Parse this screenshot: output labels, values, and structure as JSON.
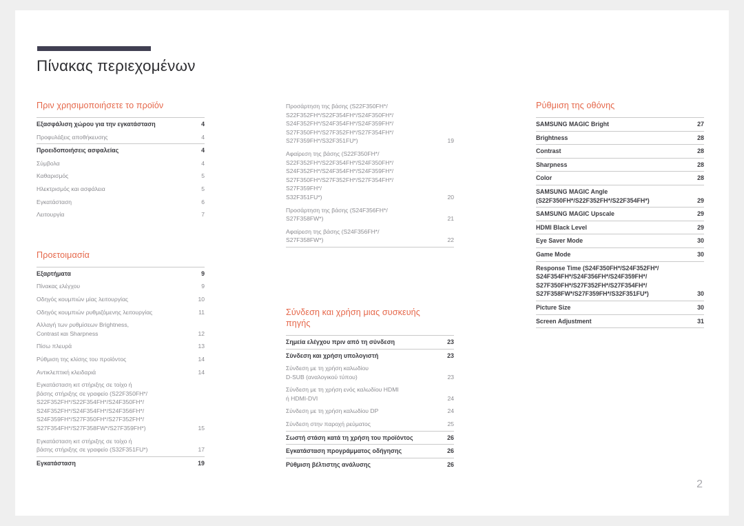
{
  "document": {
    "title": "Πίνακας περιεχομένων",
    "page_number": "2",
    "accent_color": "#e5674a",
    "rule_color": "#403f52",
    "text_color": "#3b3b40",
    "muted_text_color": "#8b8b90",
    "page_background": "#ffffff",
    "canvas_background": "#efefef"
  },
  "columns": [
    {
      "name": "column-left",
      "sections": [
        {
          "heading": "Πριν χρησιμοποιήσετε το προϊόν",
          "groups": [
            {
              "entries": [
                {
                  "label": "Εξασφάλιση χώρου για την εγκατάσταση",
                  "page": "4",
                  "level": "major"
                },
                {
                  "label": "Προφυλάξεις αποθήκευσης",
                  "page": "4",
                  "level": "minor"
                }
              ]
            },
            {
              "entries": [
                {
                  "label": "Προειδοποιήσεις ασφαλείας",
                  "page": "4",
                  "level": "major"
                },
                {
                  "label": "Σύμβολα",
                  "page": "4",
                  "level": "minor"
                },
                {
                  "label": "Καθαρισμός",
                  "page": "5",
                  "level": "minor"
                },
                {
                  "label": "Ηλεκτρισμός και ασφάλεια",
                  "page": "5",
                  "level": "minor"
                },
                {
                  "label": "Εγκατάσταση",
                  "page": "6",
                  "level": "minor"
                },
                {
                  "label": "Λειτουργία",
                  "page": "7",
                  "level": "minor"
                }
              ]
            }
          ]
        },
        {
          "heading": "Προετοιμασία",
          "groups": [
            {
              "entries": [
                {
                  "label": "Εξαρτήματα",
                  "page": "9",
                  "level": "major"
                },
                {
                  "label": "Πίνακας ελέγχου",
                  "page": "9",
                  "level": "minor"
                },
                {
                  "label": "Οδηγός κουμπιών μίας λειτουργίας",
                  "page": "10",
                  "level": "minor"
                },
                {
                  "label": "Οδηγός κουμπιών ρυθμιζόμενης λειτουργίας",
                  "page": "11",
                  "level": "minor"
                },
                {
                  "label": "Αλλαγή των ρυθμίσεων Brightness,\nContrast και Sharpness",
                  "page": "12",
                  "level": "minor"
                },
                {
                  "label": "Πίσω πλευρά",
                  "page": "13",
                  "level": "minor"
                },
                {
                  "label": "Ρύθμιση της κλίσης του προϊόντος",
                  "page": "14",
                  "level": "minor"
                },
                {
                  "label": "Αντικλεπτική κλειδαριά",
                  "page": "14",
                  "level": "minor"
                },
                {
                  "label": "Εγκατάσταση κιτ στήριξης σε τοίχο ή\nβάσης στήριξης σε γραφείο (S22F350FH*/\nS22F352FH*/S22F354FH*/S24F350FH*/\nS24F352FH*/S24F354FH*/S24F356FH*/\nS24F359FH*/S27F350FH*/S27F352FH*/\nS27F354FH*/S27F358FW*/S27F359FH*)",
                  "page": "15",
                  "level": "minor"
                },
                {
                  "label": "Εγκατάσταση κιτ στήριξης σε τοίχο ή\nβάσης στήριξης σε γραφείο (S32F351FU*)",
                  "page": "17",
                  "level": "minor"
                }
              ]
            },
            {
              "entries": [
                {
                  "label": "Εγκατάσταση",
                  "page": "19",
                  "level": "major"
                }
              ]
            }
          ]
        }
      ]
    },
    {
      "name": "column-middle",
      "sections": [
        {
          "heading": "",
          "groups": [
            {
              "no_top_rule": true,
              "entries": [
                {
                  "label": "Προσάρτηση της βάσης (S22F350FH*/\nS22F352FH*/S22F354FH*/S24F350FH*/\nS24F352FH*/S24F354FH*/S24F359FH*/\nS27F350FH*/S27F352FH*/S27F354FH*/\nS27F359FH*/S32F351FU*)",
                  "page": "19",
                  "level": "minor"
                },
                {
                  "label": "Αφαίρεση της βάσης (S22F350FH*/\nS22F352FH*/S22F354FH*/S24F350FH*/\nS24F352FH*/S24F354FH*/S24F359FH*/\nS27F350FH*/S27F352FH*/S27F354FH*/\nS27F359FH*/\nS32F351FU*)",
                  "page": "20",
                  "level": "minor"
                },
                {
                  "label": "Προσάρτηση της βάσης (S24F356FH*/\nS27F358FW*)",
                  "page": "21",
                  "level": "minor"
                },
                {
                  "label": "Αφαίρεση της βάσης (S24F356FH*/\nS27F358FW*)",
                  "page": "22",
                  "level": "minor"
                }
              ]
            }
          ]
        },
        {
          "heading": "Σύνδεση και χρήση μιας συσκευής\nπηγής",
          "groups": [
            {
              "entries": [
                {
                  "label": "Σημεία ελέγχου πριν από τη σύνδεση",
                  "page": "23",
                  "level": "major"
                }
              ]
            },
            {
              "entries": [
                {
                  "label": "Σύνδεση και χρήση υπολογιστή",
                  "page": "23",
                  "level": "major"
                },
                {
                  "label": "Σύνδεση με τη χρήση καλωδίου\nD-SUB (αναλογικού τύπου)",
                  "page": "23",
                  "level": "minor"
                },
                {
                  "label": "Σύνδεση με τη χρήση ενός καλωδίου HDMI\nή HDMI-DVI",
                  "page": "24",
                  "level": "minor"
                },
                {
                  "label": "Σύνδεση με τη χρήση καλωδίου DP",
                  "page": "24",
                  "level": "minor"
                },
                {
                  "label": "Σύνδεση στην παροχή ρεύματος",
                  "page": "25",
                  "level": "minor"
                }
              ]
            },
            {
              "entries": [
                {
                  "label": "Σωστή στάση κατά τη χρήση του προϊόντος",
                  "page": "26",
                  "level": "major"
                }
              ]
            },
            {
              "entries": [
                {
                  "label": "Εγκατάσταση προγράμματος οδήγησης",
                  "page": "26",
                  "level": "major"
                }
              ]
            },
            {
              "entries": [
                {
                  "label": "Ρύθμιση βέλτιστης ανάλυσης",
                  "page": "26",
                  "level": "major"
                }
              ]
            }
          ]
        }
      ]
    },
    {
      "name": "column-right",
      "sections": [
        {
          "heading": "Ρύθμιση της οθόνης",
          "groups": [
            {
              "entries": [
                {
                  "label": "SAMSUNG MAGIC Bright",
                  "page": "27",
                  "level": "major"
                }
              ]
            },
            {
              "entries": [
                {
                  "label": "Brightness",
                  "page": "28",
                  "level": "major"
                }
              ]
            },
            {
              "entries": [
                {
                  "label": "Contrast",
                  "page": "28",
                  "level": "major"
                }
              ]
            },
            {
              "entries": [
                {
                  "label": "Sharpness",
                  "page": "28",
                  "level": "major"
                }
              ]
            },
            {
              "entries": [
                {
                  "label": "Color",
                  "page": "28",
                  "level": "major"
                }
              ]
            },
            {
              "entries": [
                {
                  "label": "SAMSUNG MAGIC Angle\n(S22F350FH*/S22F352FH*/S22F354FH*)",
                  "page": "29",
                  "level": "major"
                }
              ]
            },
            {
              "entries": [
                {
                  "label": "SAMSUNG MAGIC Upscale",
                  "page": "29",
                  "level": "major"
                }
              ]
            },
            {
              "entries": [
                {
                  "label": "HDMI Black Level",
                  "page": "29",
                  "level": "major"
                }
              ]
            },
            {
              "entries": [
                {
                  "label": "Eye Saver Mode",
                  "page": "30",
                  "level": "major"
                }
              ]
            },
            {
              "entries": [
                {
                  "label": "Game Mode",
                  "page": "30",
                  "level": "major"
                }
              ]
            },
            {
              "entries": [
                {
                  "label": "Response Time (S24F350FH*/S24F352FH*/\nS24F354FH*/S24F356FH*/S24F359FH*/\nS27F350FH*/S27F352FH*/S27F354FH*/\nS27F358FW*/S27F359FH*/S32F351FU*)",
                  "page": "30",
                  "level": "major"
                }
              ]
            },
            {
              "entries": [
                {
                  "label": "Picture Size",
                  "page": "30",
                  "level": "major"
                }
              ]
            },
            {
              "entries": [
                {
                  "label": "Screen Adjustment",
                  "page": "31",
                  "level": "major"
                }
              ]
            }
          ]
        }
      ]
    }
  ]
}
